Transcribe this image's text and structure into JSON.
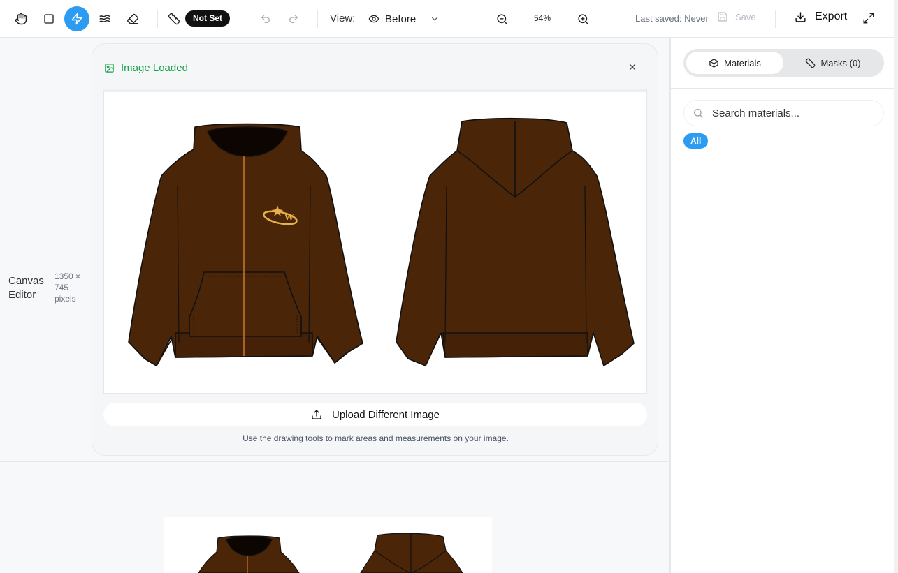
{
  "toolbar": {
    "tools": [
      {
        "name": "hand-icon",
        "active": false
      },
      {
        "name": "rectangle-icon",
        "active": false
      },
      {
        "name": "lightning-icon",
        "active": true
      },
      {
        "name": "waves-icon",
        "active": false
      },
      {
        "name": "eraser-icon",
        "active": false
      }
    ],
    "measure_badge": "Not Set",
    "view_label": "View:",
    "view_value": "Before",
    "zoom_value": "54%",
    "last_saved": "Last saved: Never",
    "save_label": "Save",
    "export_label": "Export",
    "accent_color": "#2b9cf2"
  },
  "canvas": {
    "title_line1": "Canvas",
    "title_line2": "Editor",
    "dims_line1": "1350 ×",
    "dims_line2": "745",
    "dims_line3": "pixels"
  },
  "card": {
    "status": "Image Loaded",
    "status_color": "#16a34a",
    "upload_label": "Upload Different Image",
    "hint": "Use the drawing tools to mark areas and measurements on your image."
  },
  "sidebar": {
    "tabs": [
      {
        "label": "Materials",
        "icon": "box-icon",
        "active": true
      },
      {
        "label": "Masks (0)",
        "icon": "tag-icon",
        "active": false
      }
    ],
    "search_placeholder": "Search materials...",
    "filter_chip": "All"
  },
  "image": {
    "garment_color": "#4a2508",
    "logo_color": "#e8b04a"
  }
}
